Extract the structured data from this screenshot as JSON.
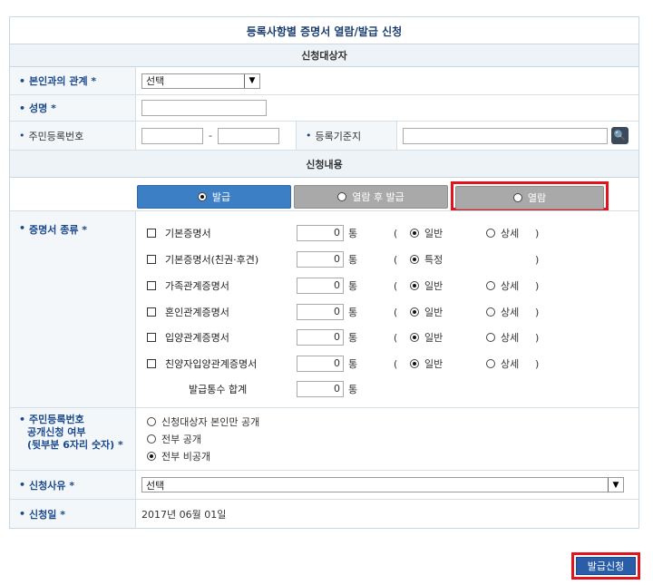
{
  "page_title": "등록사항별 증명서 열람/발급 신청",
  "section_target": "신청대상자",
  "section_content": "신청내용",
  "fields": {
    "relation_label": "본인과의 관계 *",
    "relation_value": "선택",
    "name_label": "성명 *",
    "rrn_label": "주민등록번호",
    "rrn_dash": "-",
    "registry_label": "등록기준지",
    "search_icon": "search-icon"
  },
  "tabs": [
    {
      "label": "발급",
      "selected": true
    },
    {
      "label": "열람 후 발급",
      "selected": false
    },
    {
      "label": "열람",
      "selected": false
    }
  ],
  "cert_type_label": "증명서 종류 *",
  "certs": [
    {
      "name": "기본증명서",
      "qty": "0",
      "unit": "통",
      "opt1": "일반",
      "opt2": "상세",
      "opt1_on": true
    },
    {
      "name": "기본증명서(친권·후견)",
      "qty": "0",
      "unit": "통",
      "opt1": "특정",
      "opt2": "",
      "opt1_on": true
    },
    {
      "name": "가족관계증명서",
      "qty": "0",
      "unit": "통",
      "opt1": "일반",
      "opt2": "상세",
      "opt1_on": true
    },
    {
      "name": "혼인관계증명서",
      "qty": "0",
      "unit": "통",
      "opt1": "일반",
      "opt2": "상세",
      "opt1_on": true
    },
    {
      "name": "입양관계증명서",
      "qty": "0",
      "unit": "통",
      "opt1": "일반",
      "opt2": "상세",
      "opt1_on": true
    },
    {
      "name": "친양자입양관계증명서",
      "qty": "0",
      "unit": "통",
      "opt1": "일반",
      "opt2": "상세",
      "opt1_on": true
    }
  ],
  "paren_open": "(",
  "paren_close": ")",
  "total_label": "발급통수 합계",
  "total_qty": "0",
  "total_unit": "통",
  "disclosure": {
    "label_line1": "주민등록번호",
    "label_line2": "공개신청 여부",
    "label_line3": "(뒷부분 6자리 숫자) *",
    "options": [
      {
        "label": "신청대상자 본인만 공개",
        "selected": false
      },
      {
        "label": "전부 공개",
        "selected": false
      },
      {
        "label": "전부 비공개",
        "selected": true
      }
    ]
  },
  "reason_label": "신청사유 *",
  "reason_value": "선택",
  "date_label": "신청일 *",
  "date_value": "2017년 06월 01일",
  "submit_label": "발급신청"
}
